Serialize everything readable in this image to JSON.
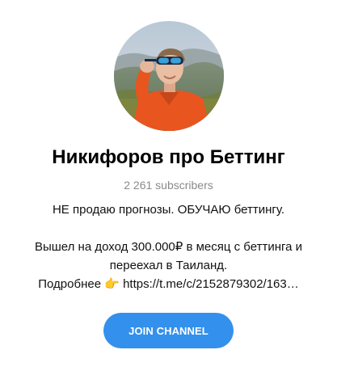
{
  "channel": {
    "title": "Никифоров про Беттинг",
    "subscribers": "2 261 subscribers",
    "description": {
      "line1": "НЕ продаю прогнозы. ОБУЧАЮ беттингу.",
      "line2": "Вышел на доход 300.000₽ в месяц с беттинга и",
      "line3": "переехал в Таиланд.",
      "more_label": "Подробнее",
      "pointer_emoji": "👉",
      "link": "https://t.me/c/2152879302/163…"
    }
  },
  "actions": {
    "join_label": "JOIN CHANNEL"
  },
  "colors": {
    "accent": "#3390ec",
    "subtitle": "#8a8a8a",
    "shirt": "#e8551f"
  },
  "icons": {
    "avatar": "channel-avatar-photo"
  }
}
